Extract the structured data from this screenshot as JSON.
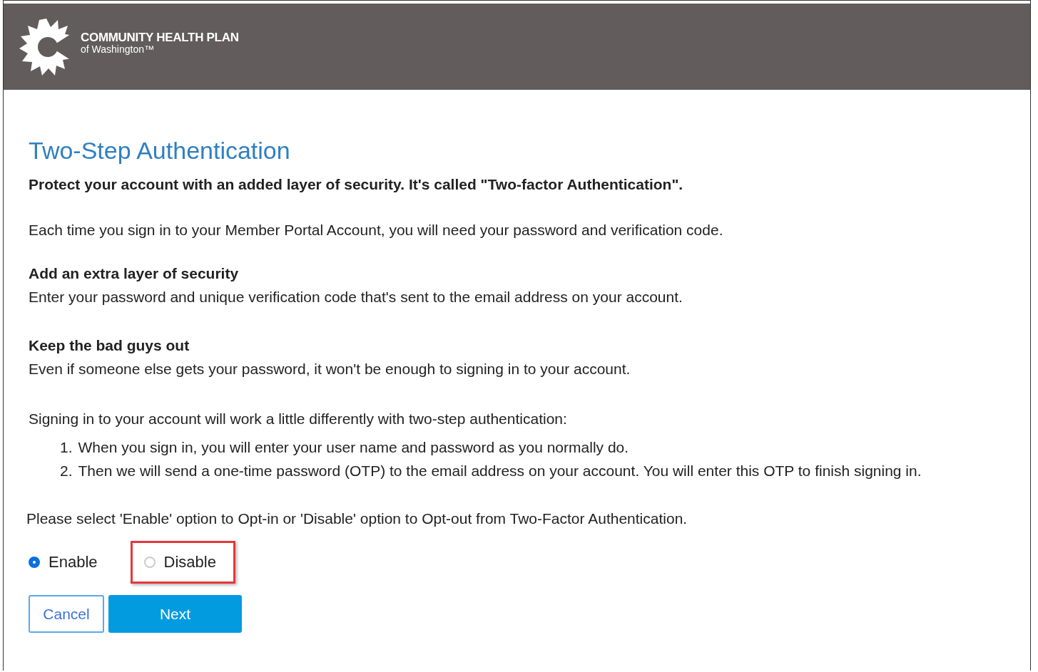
{
  "header": {
    "logo_name": "COMMUNITY HEALTH PLAN",
    "logo_sub": "of Washington™"
  },
  "title": "Two-Step Authentication",
  "lead": "Protect your account with an added layer of security. It's called \"Two-factor Authentication\".",
  "intro": "Each time you sign in to your Member Portal Account, you will need your password and verification code.",
  "sections": [
    {
      "heading": "Add an extra layer of security",
      "text": "Enter your password and unique verification code that's sent to the email address on your account."
    },
    {
      "heading": "Keep the bad guys out",
      "text": "Even if someone else gets your password, it won't be enough to signing in to your account."
    }
  ],
  "steps_intro": "Signing in to your account will work a little differently with two-step authentication:",
  "steps": [
    {
      "number": "1.",
      "text": "When you sign in, you will enter your user name and password as you normally do."
    },
    {
      "number": "2.",
      "text": "Then we will send a one-time password (OTP) to the email address on your account. You will enter this OTP to finish signing in."
    }
  ],
  "prompt": "Please select 'Enable' option to Opt-in or 'Disable' option to Opt-out from Two-Factor Authentication.",
  "options": [
    {
      "label": "Enable",
      "selected": true,
      "highlighted": false
    },
    {
      "label": "Disable",
      "selected": false,
      "highlighted": true
    }
  ],
  "buttons": [
    {
      "label": "Cancel",
      "kind": "secondary"
    },
    {
      "label": "Next",
      "kind": "primary"
    }
  ]
}
